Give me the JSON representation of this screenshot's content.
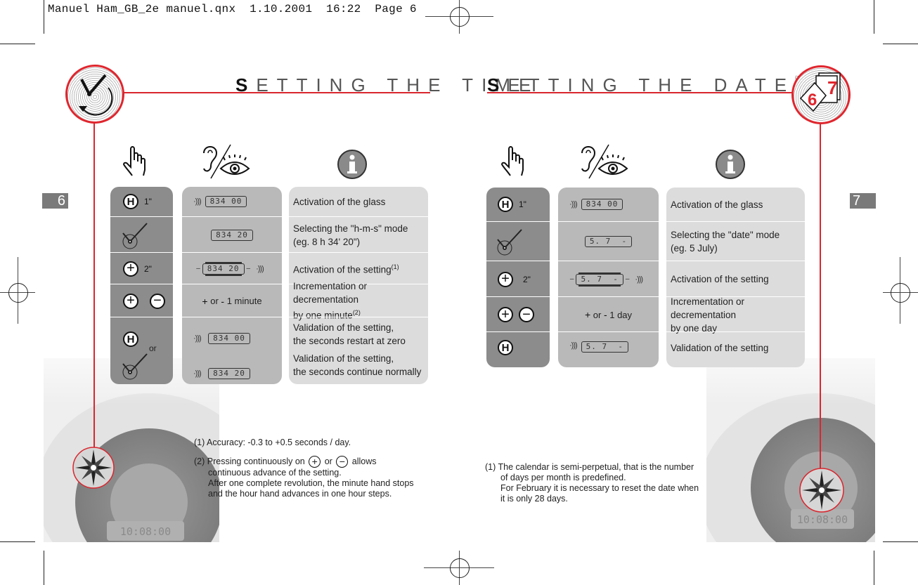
{
  "slug": {
    "text": "Manuel Ham_GB_2e manuel.qnx  1.10.2001  16:22  Page 6"
  },
  "left_page": {
    "page_number": "6",
    "title_first": "S",
    "title_rest": "ETTING THE TIME",
    "emblem_icon": "clock-hands-icon",
    "column_icons": [
      "hand-press-icon",
      "ear-eye-icon",
      "info-icon"
    ],
    "rows": [
      {
        "action": {
          "buttons": [
            "H"
          ],
          "duration": "1\""
        },
        "display": {
          "beep": true,
          "lcd": "834 00",
          "flash": "seconds"
        },
        "info": "Activation of the glass"
      },
      {
        "action": {
          "crown": true
        },
        "display": {
          "lcd": "834 20"
        },
        "info_line1": "Selecting the \"h-m-s\" mode",
        "info_line2": "(eg. 8 h 34' 20\")"
      },
      {
        "action": {
          "buttons": [
            "+"
          ],
          "duration": "2\""
        },
        "display": {
          "lcd": "834 20",
          "flashing": true,
          "beep": true
        },
        "info": "Activation of the setting",
        "info_sup": "(1)"
      },
      {
        "action": {
          "buttons": [
            "+",
            "−"
          ]
        },
        "display": {
          "text_plus": "+",
          "text_or": "or",
          "text_minus": "-",
          "text_rest": "1 minute"
        },
        "info_line1": "Incrementation or decrementation",
        "info_line2": "by one minute",
        "info_sup": "(2)"
      },
      {
        "action": {
          "buttons": [
            "H"
          ],
          "or": "or",
          "crown": true
        },
        "display": {
          "lcd_a": "834 00",
          "lcd_b": "834 20",
          "beep": true
        },
        "info_a_line1": "Validation of the setting,",
        "info_a_line2": "the seconds restart at zero",
        "info_b_line1": "Validation of the setting,",
        "info_b_line2": "the seconds continue normally"
      }
    ],
    "footnotes": {
      "f1": "(1) Accuracy: -0.3 to +0.5 seconds / day.",
      "f2_prefix": "(2) Pressing continuously on",
      "f2_plus": "+",
      "f2_or": "or",
      "f2_minus": "−",
      "f2_suffix": "allows",
      "f2_line2": "continuous advance of the setting.",
      "f2_line3": "After one complete revolution, the minute hand stops",
      "f2_line4": "and the hour hand advances in one hour steps."
    },
    "watch_lcd": "10:08:00"
  },
  "right_page": {
    "page_number": "7",
    "title_first": "S",
    "title_rest": "ETTING THE DATE",
    "title_sup": "(1)",
    "emblem_icon": "calendar-pages-icon",
    "emblem_digits": [
      "6",
      "7"
    ],
    "column_icons": [
      "hand-press-icon",
      "ear-eye-icon",
      "info-icon"
    ],
    "rows": [
      {
        "action": {
          "buttons": [
            "H"
          ],
          "duration": "1\""
        },
        "display": {
          "beep": true,
          "lcd": "834 00"
        },
        "info": "Activation of the glass"
      },
      {
        "action": {
          "crown": true
        },
        "display": {
          "lcd": "5. 7  -"
        },
        "info_line1": "Selecting the \"date\" mode",
        "info_line2": "(eg. 5 July)"
      },
      {
        "action": {
          "buttons": [
            "+"
          ],
          "duration": "2\""
        },
        "display": {
          "lcd": "5. 7  -",
          "flashing": true,
          "beep": true
        },
        "info": "Activation of the setting"
      },
      {
        "action": {
          "buttons": [
            "+",
            "−"
          ]
        },
        "display": {
          "text_plus": "+",
          "text_or": "or",
          "text_minus": "-",
          "text_rest": "1 day"
        },
        "info_line1": "Incrementation or decrementation",
        "info_line2": "by one day"
      },
      {
        "action": {
          "buttons": [
            "H"
          ]
        },
        "display": {
          "beep": true,
          "lcd": "5. 7  -"
        },
        "info": "Validation of the setting"
      }
    ],
    "footnote": {
      "line1": "(1)  The calendar is semi-perpetual, that is the number",
      "line2": "of days per month is predefined.",
      "line3": "For February it is necessary to reset the date when",
      "line4": "it is only 28 days."
    },
    "watch_lcd": "10:08:00"
  },
  "beep_glyph": "·)))",
  "colors": {
    "accent_red": "#d9262e",
    "dark_gray": "#8c8c8c",
    "mid_gray": "#b9b9b9",
    "light_gray": "#dcdcdc"
  }
}
